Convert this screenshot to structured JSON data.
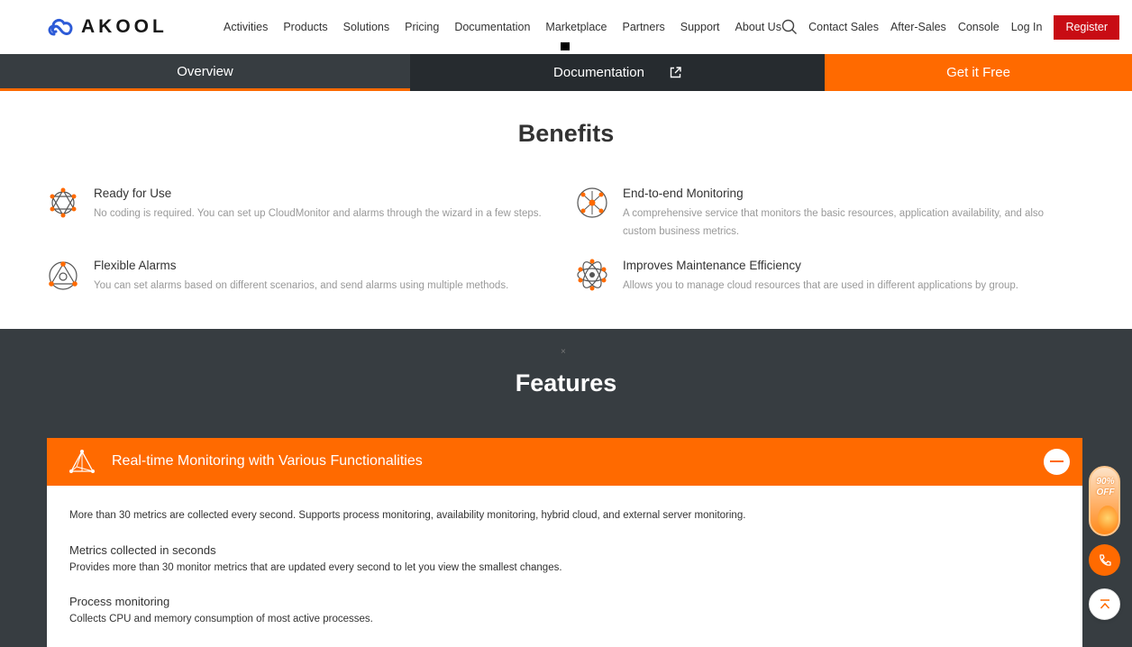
{
  "brand": {
    "name": "AKOOL",
    "accent": "#ff6a00",
    "register_color": "#c80c14"
  },
  "nav": {
    "links": [
      "Activities",
      "Products",
      "Solutions",
      "Pricing",
      "Documentation",
      "Marketplace",
      "Partners",
      "Support",
      "About Us"
    ],
    "right_links": [
      "Contact Sales",
      "After-Sales",
      "Console",
      "Log In"
    ],
    "register": "Register",
    "search_icon": "search-icon"
  },
  "subtabs": {
    "overview": "Overview",
    "documentation": "Documentation",
    "get_free": "Get it Free"
  },
  "benefits": {
    "title": "Benefits",
    "items": [
      {
        "title": "Ready for Use",
        "desc": "No coding is required. You can set up CloudMonitor and alarms through the wizard in a few steps.",
        "icon": "network-icon"
      },
      {
        "title": "End-to-end Monitoring",
        "desc": "A comprehensive service that monitors the basic resources, application availability, and also custom business metrics.",
        "icon": "hub-icon"
      },
      {
        "title": "Flexible Alarms",
        "desc": "You can set alarms based on different scenarios, and send alarms using multiple methods.",
        "icon": "triangle-nodes-icon"
      },
      {
        "title": "Improves Maintenance Efficiency",
        "desc": "Allows you to manage cloud resources that are used in different applications by group.",
        "icon": "atom-icon"
      }
    ]
  },
  "features": {
    "title": "Features",
    "close_glyph": "×",
    "panel": {
      "title": "Real-time Monitoring with Various Functionalities",
      "intro": "More than 30 metrics are collected every second. Supports process monitoring, availability monitoring, hybrid cloud, and external server monitoring.",
      "items": [
        {
          "title": "Metrics collected in seconds",
          "desc": "Provides more than 30 monitor metrics that are updated every second to let you view the smallest changes."
        },
        {
          "title": "Process monitoring",
          "desc": "Collects CPU and memory consumption of most active processes."
        }
      ]
    }
  },
  "floating": {
    "promo": "90% OFF",
    "phone_icon": "phone-icon",
    "top_icon": "back-to-top-icon"
  }
}
